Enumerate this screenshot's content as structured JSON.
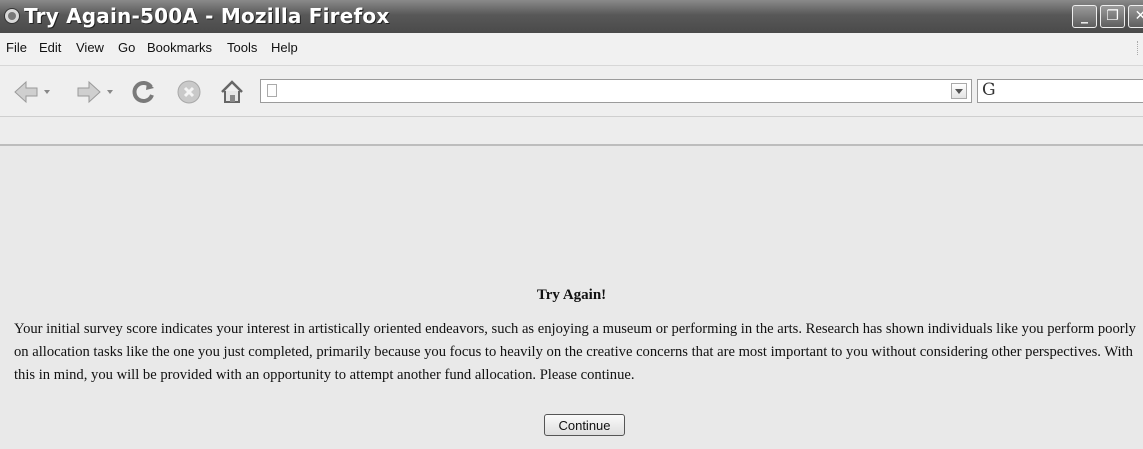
{
  "window": {
    "title": "Try Again-500A - Mozilla Firefox"
  },
  "menu": [
    "File",
    "Edit",
    "View",
    "Go",
    "Bookmarks",
    "Tools",
    "Help"
  ],
  "toolbar": {
    "address_value": "",
    "search_engine_icon": "G"
  },
  "page": {
    "heading": "Try Again!",
    "message": "Your initial survey score indicates your interest in artistically oriented endeavors, such as enjoying a museum or performing in the arts. Research has shown individuals like you perform poorly on allocation tasks like the one you just completed, primarily because you focus to heavily on the creative concerns that are most important to you without considering other perspectives. With this in mind, you will be provided with an opportunity to attempt another fund allocation. Please continue.",
    "continue_label": "Continue"
  },
  "colors": {
    "titlebar": "#585858",
    "chrome": "#efefef",
    "content_bg": "#e9e9e9"
  },
  "icons": [
    "firefox-icon",
    "minimize-icon",
    "maximize-icon",
    "back-arrow-icon",
    "forward-arrow-icon",
    "reload-icon",
    "stop-icon",
    "home-icon",
    "page-icon",
    "dropdown-arrow-icon",
    "search-engine-icon"
  ]
}
